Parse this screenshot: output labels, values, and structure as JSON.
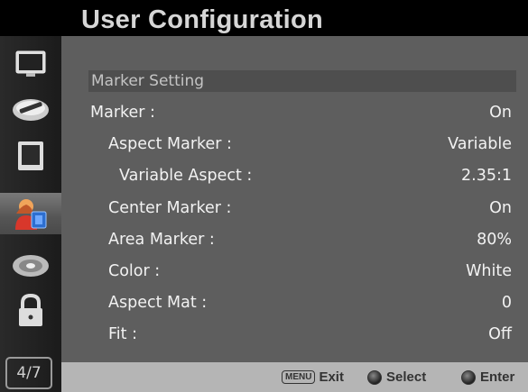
{
  "header": {
    "title": "User Configuration"
  },
  "sidebar": {
    "items": [
      {
        "icon": "monitor-icon",
        "active": false
      },
      {
        "icon": "color-adjust-icon",
        "active": false
      },
      {
        "icon": "display-frame-icon",
        "active": false
      },
      {
        "icon": "user-config-icon",
        "active": true
      },
      {
        "icon": "audio-disc-icon",
        "active": false
      },
      {
        "icon": "lock-icon",
        "active": false
      }
    ],
    "page_indicator": "4/7"
  },
  "menu": {
    "section_header": "Marker Setting",
    "rows": [
      {
        "label": "Marker :",
        "value": "On"
      },
      {
        "label": "Aspect Marker :",
        "value": "Variable"
      },
      {
        "label": "Variable Aspect :",
        "value": "2.35:1"
      },
      {
        "label": "Center Marker :",
        "value": "On"
      },
      {
        "label": "Area Marker :",
        "value": "80%"
      },
      {
        "label": "Color :",
        "value": "White"
      },
      {
        "label": "Aspect Mat :",
        "value": "0"
      },
      {
        "label": "Fit :",
        "value": "Off"
      }
    ]
  },
  "footer": {
    "exit_key": "MENU",
    "exit_label": "Exit",
    "select_label": "Select",
    "enter_label": "Enter"
  }
}
